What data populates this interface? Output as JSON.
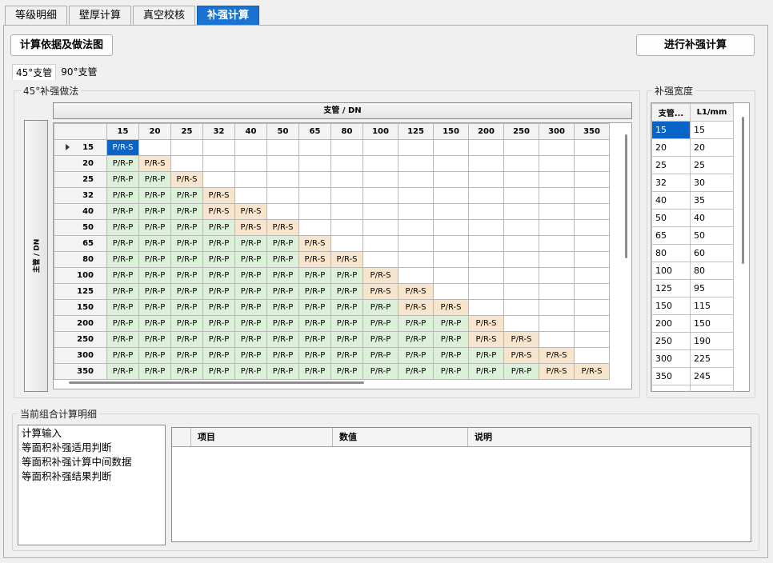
{
  "top_tabs": [
    "等级明细",
    "壁厚计算",
    "真空校核",
    "补强计算"
  ],
  "top_tabs_active": 3,
  "buttons": {
    "basis": "计算依据及做法图",
    "calc": "进行补强计算"
  },
  "sub_tabs": [
    "45°支管",
    "90°支管"
  ],
  "sub_tabs_active": 0,
  "matrix": {
    "group_label": "45°补强做法",
    "column_header": "支管 / DN",
    "row_header": "主管 / DN",
    "columns": [
      "15",
      "20",
      "25",
      "32",
      "40",
      "50",
      "65",
      "80",
      "100",
      "125",
      "150",
      "200",
      "250",
      "300",
      "350"
    ],
    "rows": [
      "15",
      "20",
      "25",
      "32",
      "40",
      "50",
      "65",
      "80",
      "100",
      "125",
      "150",
      "200",
      "250",
      "300",
      "350"
    ],
    "cells": [
      [
        "P/R-S"
      ],
      [
        "P/R-P",
        "P/R-S"
      ],
      [
        "P/R-P",
        "P/R-P",
        "P/R-S"
      ],
      [
        "P/R-P",
        "P/R-P",
        "P/R-P",
        "P/R-S"
      ],
      [
        "P/R-P",
        "P/R-P",
        "P/R-P",
        "P/R-S",
        "P/R-S"
      ],
      [
        "P/R-P",
        "P/R-P",
        "P/R-P",
        "P/R-P",
        "P/R-S",
        "P/R-S"
      ],
      [
        "P/R-P",
        "P/R-P",
        "P/R-P",
        "P/R-P",
        "P/R-P",
        "P/R-P",
        "P/R-S"
      ],
      [
        "P/R-P",
        "P/R-P",
        "P/R-P",
        "P/R-P",
        "P/R-P",
        "P/R-P",
        "P/R-S",
        "P/R-S"
      ],
      [
        "P/R-P",
        "P/R-P",
        "P/R-P",
        "P/R-P",
        "P/R-P",
        "P/R-P",
        "P/R-P",
        "P/R-P",
        "P/R-S"
      ],
      [
        "P/R-P",
        "P/R-P",
        "P/R-P",
        "P/R-P",
        "P/R-P",
        "P/R-P",
        "P/R-P",
        "P/R-P",
        "P/R-S",
        "P/R-S"
      ],
      [
        "P/R-P",
        "P/R-P",
        "P/R-P",
        "P/R-P",
        "P/R-P",
        "P/R-P",
        "P/R-P",
        "P/R-P",
        "P/R-P",
        "P/R-S",
        "P/R-S"
      ],
      [
        "P/R-P",
        "P/R-P",
        "P/R-P",
        "P/R-P",
        "P/R-P",
        "P/R-P",
        "P/R-P",
        "P/R-P",
        "P/R-P",
        "P/R-P",
        "P/R-P",
        "P/R-S"
      ],
      [
        "P/R-P",
        "P/R-P",
        "P/R-P",
        "P/R-P",
        "P/R-P",
        "P/R-P",
        "P/R-P",
        "P/R-P",
        "P/R-P",
        "P/R-P",
        "P/R-P",
        "P/R-S",
        "P/R-S"
      ],
      [
        "P/R-P",
        "P/R-P",
        "P/R-P",
        "P/R-P",
        "P/R-P",
        "P/R-P",
        "P/R-P",
        "P/R-P",
        "P/R-P",
        "P/R-P",
        "P/R-P",
        "P/R-P",
        "P/R-S",
        "P/R-S"
      ],
      [
        "P/R-P",
        "P/R-P",
        "P/R-P",
        "P/R-P",
        "P/R-P",
        "P/R-P",
        "P/R-P",
        "P/R-P",
        "P/R-P",
        "P/R-P",
        "P/R-P",
        "P/R-P",
        "P/R-P",
        "P/R-S",
        "P/R-S"
      ]
    ],
    "selected": {
      "row": 0,
      "col": 0
    },
    "current_row": 0
  },
  "width_table": {
    "group_label": "补强宽度",
    "headers": [
      "支管...",
      "L1/mm"
    ],
    "rows": [
      [
        "15",
        "15"
      ],
      [
        "20",
        "20"
      ],
      [
        "25",
        "25"
      ],
      [
        "32",
        "30"
      ],
      [
        "40",
        "35"
      ],
      [
        "50",
        "40"
      ],
      [
        "65",
        "50"
      ],
      [
        "80",
        "60"
      ],
      [
        "100",
        "80"
      ],
      [
        "125",
        "95"
      ],
      [
        "150",
        "115"
      ],
      [
        "200",
        "150"
      ],
      [
        "250",
        "190"
      ],
      [
        "300",
        "225"
      ],
      [
        "350",
        "245"
      ]
    ],
    "selected_row": 0
  },
  "detail": {
    "group_label": "当前组合计算明细",
    "list_items": [
      "计算输入",
      "等面积补强适用判断",
      "等面积补强计算中间数据",
      "等面积补强结果判断"
    ],
    "columns": [
      "项目",
      "数值",
      "说明"
    ]
  },
  "colors": {
    "accent": "#1a73d1",
    "selected": "#0a64c8",
    "pipe_p": "#dcefd9",
    "pipe_s": "#f7e4cc"
  }
}
